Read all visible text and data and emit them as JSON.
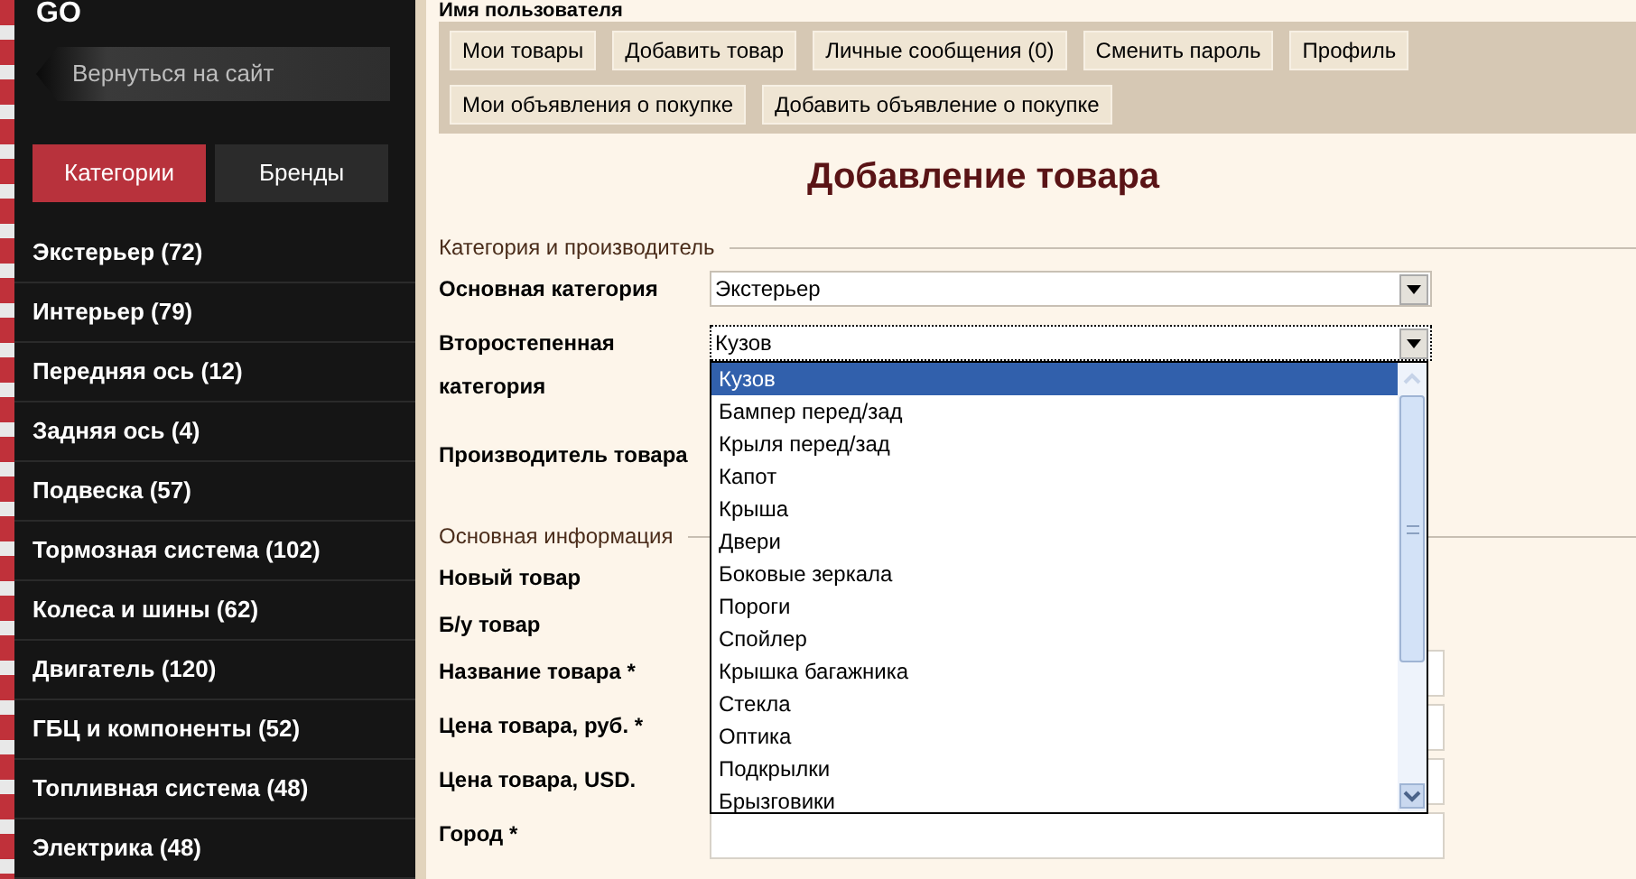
{
  "sidebar": {
    "logo_text": "GO",
    "back_button": "Вернуться на сайт",
    "tabs": [
      {
        "label": "Категории",
        "selected": true
      },
      {
        "label": "Бренды",
        "selected": false
      }
    ],
    "items": [
      "Экстерьер (72)",
      "Интерьер (79)",
      "Передняя ось (12)",
      "Задняя ось (4)",
      "Подвеска (57)",
      "Тормозная система (102)",
      "Колеса и шины (62)",
      "Двигатель (120)",
      "ГБЦ и компоненты (52)",
      "Топливная система (48)",
      "Электрика (48)"
    ]
  },
  "header": {
    "username": "Имя пользователя",
    "nav_rows": [
      [
        "Мои товары",
        "Добавить товар",
        "Личные сообщения (0)",
        "Сменить пароль",
        "Профиль"
      ],
      [
        "Мои объявления о покупке",
        "Добавить объявление о покупке"
      ]
    ]
  },
  "title": "Добавление товара",
  "sections": [
    {
      "title": "Категория и производитель",
      "fields": [
        {
          "kind": "select",
          "label": "Основная категория",
          "value": "Экстерьер"
        },
        {
          "kind": "select",
          "label": "Второстепенная категория",
          "value": "Кузов",
          "dropdown": {
            "options": [
              {
                "label": "Кузов",
                "selected": true
              },
              {
                "label": "Бампер перед/зад",
                "selected": false
              },
              {
                "label": "Крыля перед/зад",
                "selected": false
              },
              {
                "label": "Капот",
                "selected": false
              },
              {
                "label": "Крыша",
                "selected": false
              },
              {
                "label": "Двери",
                "selected": false
              },
              {
                "label": "Боковые зеркала",
                "selected": false
              },
              {
                "label": "Пороги",
                "selected": false
              },
              {
                "label": "Спойлер",
                "selected": false
              },
              {
                "label": "Крышка багажника",
                "selected": false
              },
              {
                "label": "Стекла",
                "selected": false
              },
              {
                "label": "Оптика",
                "selected": false
              },
              {
                "label": "Подкрылки",
                "selected": false
              },
              {
                "label": "Брызговики",
                "selected": false
              }
            ]
          }
        },
        {
          "kind": "hidden",
          "label": "Производитель товара"
        }
      ]
    },
    {
      "title": "Основная информация",
      "fields": [
        {
          "kind": "hidden",
          "label": "Новый товар"
        },
        {
          "kind": "hidden",
          "label": "Б/у товар"
        },
        {
          "kind": "text",
          "label": "Название товара *"
        },
        {
          "kind": "text",
          "label": "Цена товара, руб. *"
        },
        {
          "kind": "text",
          "label": "Цена товара, USD."
        },
        {
          "kind": "text",
          "label": "Город *"
        }
      ]
    }
  ]
}
